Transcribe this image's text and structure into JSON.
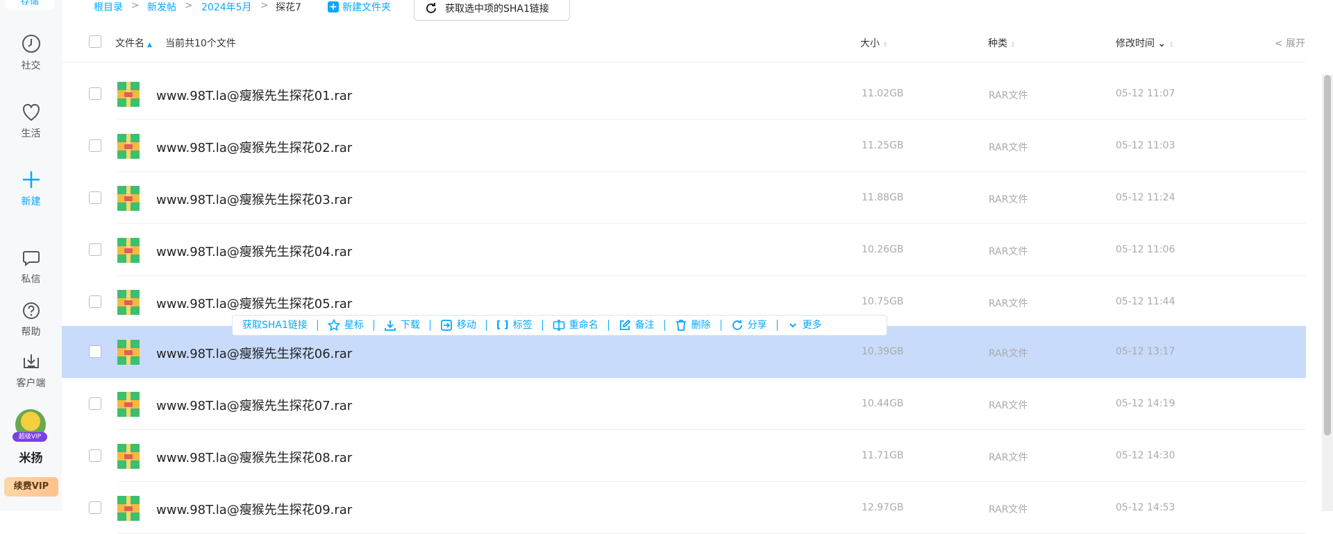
{
  "sidebar": {
    "top_label": "存储",
    "items": [
      {
        "label": "社交",
        "icon": "clock-icon"
      },
      {
        "label": "生活",
        "icon": "heart-icon"
      },
      {
        "label": "新建",
        "icon": "plus-icon"
      },
      {
        "label": "私信",
        "icon": "chat-icon"
      },
      {
        "label": "帮助",
        "icon": "help-icon"
      },
      {
        "label": "客户端",
        "icon": "download-icon"
      }
    ],
    "vip_badge": "超级VIP",
    "username": "米扬",
    "vip_button": "续费VIP"
  },
  "breadcrumb": [
    {
      "label": "根目录"
    },
    {
      "label": "新发帖"
    },
    {
      "label": "2024年5月"
    },
    {
      "label": "探花7"
    }
  ],
  "toolbar": {
    "new_folder": "新建文件夹",
    "sha_button": "获取选中项的SHA1链接"
  },
  "header": {
    "name": "文件名",
    "count_text": "当前共10个文件",
    "size": "大小",
    "type": "种类",
    "mtime": "修改时间",
    "expand": "展开"
  },
  "files": [
    {
      "name": "www.98T.la@瘦猴先生探花01.rar",
      "size": "11.02GB",
      "type": "RAR文件",
      "mtime": "05-12 11:07"
    },
    {
      "name": "www.98T.la@瘦猴先生探花02.rar",
      "size": "11.25GB",
      "type": "RAR文件",
      "mtime": "05-12 11:03"
    },
    {
      "name": "www.98T.la@瘦猴先生探花03.rar",
      "size": "11.88GB",
      "type": "RAR文件",
      "mtime": "05-12 11:24"
    },
    {
      "name": "www.98T.la@瘦猴先生探花04.rar",
      "size": "10.26GB",
      "type": "RAR文件",
      "mtime": "05-12 11:06"
    },
    {
      "name": "www.98T.la@瘦猴先生探花05.rar",
      "size": "10.75GB",
      "type": "RAR文件",
      "mtime": "05-12 11:44"
    },
    {
      "name": "www.98T.la@瘦猴先生探花06.rar",
      "size": "10.39GB",
      "type": "RAR文件",
      "mtime": "05-12 13:17"
    },
    {
      "name": "www.98T.la@瘦猴先生探花07.rar",
      "size": "10.44GB",
      "type": "RAR文件",
      "mtime": "05-12 14:19"
    },
    {
      "name": "www.98T.la@瘦猴先生探花08.rar",
      "size": "11.71GB",
      "type": "RAR文件",
      "mtime": "05-12 14:30"
    },
    {
      "name": "www.98T.la@瘦猴先生探花09.rar",
      "size": "12.97GB",
      "type": "RAR文件",
      "mtime": "05-12 14:53"
    }
  ],
  "actions": [
    {
      "label": "获取SHA1链接",
      "icon": ""
    },
    {
      "label": "星标",
      "icon": "star-icon"
    },
    {
      "label": "下载",
      "icon": "download-icon"
    },
    {
      "label": "移动",
      "icon": "move-icon"
    },
    {
      "label": "标签",
      "icon": "tag-icon"
    },
    {
      "label": "重命名",
      "icon": "rename-icon"
    },
    {
      "label": "备注",
      "icon": "edit-icon"
    },
    {
      "label": "删除",
      "icon": "trash-icon"
    },
    {
      "label": "分享",
      "icon": "share-icon"
    },
    {
      "label": "更多",
      "icon": "chevron-down-icon"
    }
  ],
  "colors": {
    "accent": "#06a7ff",
    "selected_row": "#c8dbfb"
  }
}
